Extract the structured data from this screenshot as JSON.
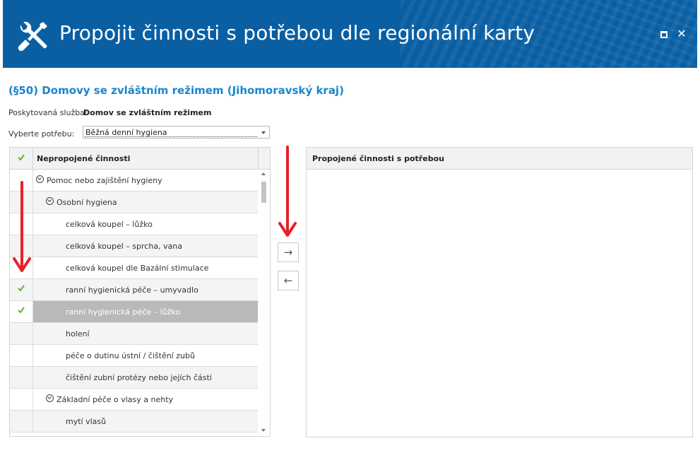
{
  "window": {
    "title": "Propojit činnosti s potřebou dle regionální karty",
    "header_color": "#0a5fa3"
  },
  "section_title": "(§50) Domovy se zvláštním režimem (Jihomoravský kraj)",
  "service": {
    "label": "Poskytovaná služba:",
    "value": "Domov se zvláštním režimem"
  },
  "need": {
    "label": "Vyberte potřebu:",
    "selected": "Běžná denní hygiena"
  },
  "left_grid": {
    "header": "Nepropojené činnosti",
    "rows": [
      {
        "label": "Pomoc nebo zajištění hygieny",
        "level": 0,
        "group": true,
        "checked": false
      },
      {
        "label": "Osobní hygiena",
        "level": 1,
        "group": true,
        "checked": false
      },
      {
        "label": "celková koupel – lůžko",
        "level": 2,
        "group": false,
        "checked": false
      },
      {
        "label": "celková koupel – sprcha, vana",
        "level": 2,
        "group": false,
        "checked": false
      },
      {
        "label": "celková koupel dle Bazální stimulace",
        "level": 2,
        "group": false,
        "checked": false
      },
      {
        "label": "ranní hygienická péče – umyvadlo",
        "level": 2,
        "group": false,
        "checked": true
      },
      {
        "label": "ranní hygienická péče – lůžko",
        "level": 2,
        "group": false,
        "checked": true,
        "selected": true
      },
      {
        "label": "holení",
        "level": 2,
        "group": false,
        "checked": false
      },
      {
        "label": "péče o dutinu ústní / čištění zubů",
        "level": 2,
        "group": false,
        "checked": false
      },
      {
        "label": "čištění zubní protézy nebo jejích částí",
        "level": 2,
        "group": false,
        "checked": false
      },
      {
        "label": "Základní péče o vlasy a nehty",
        "level": 1,
        "group": true,
        "checked": false
      },
      {
        "label": "mytí vlasů",
        "level": 2,
        "group": false,
        "checked": false
      }
    ]
  },
  "right_grid": {
    "header": "Propojené činnosti s potřebou"
  },
  "buttons": {
    "move_right": "→",
    "move_left": "←"
  },
  "colors": {
    "accent": "#1a86cc",
    "check": "#5cb531",
    "annotation": "#e8202a"
  }
}
